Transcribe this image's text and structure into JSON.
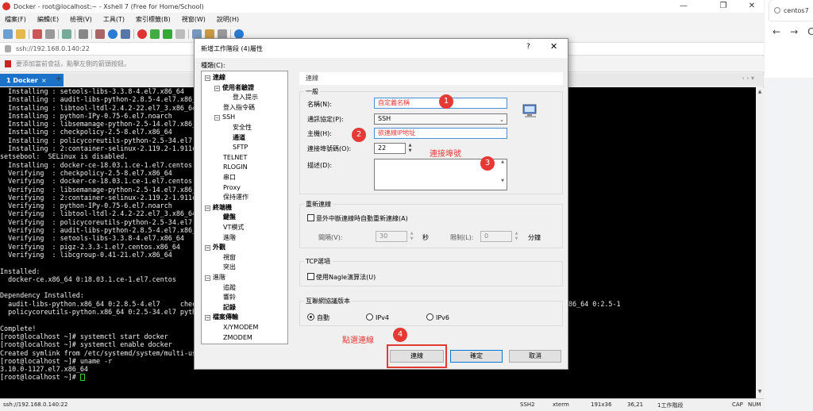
{
  "window": {
    "title": "Docker - root@localhost:~ - Xshell 7 (Free for Home/School)",
    "controls": [
      "—",
      "❐",
      "✕"
    ]
  },
  "menu": [
    "檔案(F)",
    "編輯(E)",
    "檢視(V)",
    "工具(T)",
    "索引標籤(B)",
    "視窗(W)",
    "說明(H)"
  ],
  "address": "ssh://192.168.0.140:22",
  "hint": "要添加當前會話，點擊左側的箭頭按鈕。",
  "tab": {
    "label": "1 Docker",
    "close": "×",
    "add": "+"
  },
  "tab_nav": "‹  ›  ▾",
  "terminal": {
    "lines": [
      "  Installing : setools-libs-3.3.8-4.el7.x86_64",
      "  Installing : audit-libs-python-2.8.5-4.el7.x86_6",
      "  Installing : libtool-ltdl-2.4.2-22.el7_3.x86_64",
      "  Installing : python-IPy-0.75-6.el7.noarch",
      "  Installing : libsemanage-python-2.5-14.el7.x86_6",
      "  Installing : checkpolicy-2.5-8.el7.x86_64",
      "  Installing : policycoreutils-python-2.5-34.el7.",
      "  Installing : 2:container-selinux-2.119.2-1.911c",
      "setsebool:  SELinux is disabled.",
      "  Installing : docker-ce-18.03.1.ce-1.el7.centos.",
      "  Verifying  : checkpolicy-2.5-8.el7.x86_64",
      "  Verifying  : docker-ce-18.03.1.ce-1.el7.centos.",
      "  Verifying  : libsemanage-python-2.5-14.el7.x86_6",
      "  Verifying  : 2:container-selinux-2.119.2-1.911c",
      "  Verifying  : python-IPy-0.75-6.el7.noarch",
      "  Verifying  : libtool-ltdl-2.4.2-22.el7_3.x86_64",
      "  Verifying  : policycoreutils-python-2.5-34.el7.",
      "  Verifying  : audit-libs-python-2.8.5-4.el7.x86_6",
      "  Verifying  : setools-libs-3.3.8-4.el7.x86_64",
      "  Verifying  : pigz-2.3.3-1.el7.centos.x86_64",
      "  Verifying  : libcgroup-0.41-21.el7.x86_64",
      "",
      "Installed:",
      "  docker-ce.x86_64 0:18.03.1.ce-1.el7.centos",
      "",
      "Dependency Installed:",
      "  audit-libs-python.x86_64 0:2.8.5-4.el7     check                                                            0.41-21.el7 libsemanage-python.x86_64 0:2.5-1",
      "  policycoreutils-python.x86_64 0:2.5-34.el7 pytho",
      "",
      "Complete!",
      "[root@localhost ~]# systemctl start docker",
      "[root@localhost ~]# systemctl enable docker",
      "Created symlink from /etc/systemd/system/multi-use",
      "[root@localhost ~]# uname -r",
      "3.10.0-1127.el7.x86_64",
      "[root@localhost ~]# "
    ]
  },
  "statusbar": {
    "address": "ssh://192.168.0.140:22",
    "protocol": "SSH2",
    "term": "xterm",
    "size": "191x36",
    "pos": "36,21",
    "sessions": "1工作階段",
    "caps": "CAP",
    "num": "NUM"
  },
  "browser": {
    "tab_label": "centos7",
    "back": "←",
    "forward": "→",
    "reload": "C"
  },
  "dialog": {
    "title": "新增工作階段 (4)屬性",
    "help": "?",
    "close": "✕",
    "category_label": "種類(C):",
    "tree": [
      {
        "label": "連線",
        "bold": true,
        "expander": "−"
      },
      {
        "label": "使用者驗證",
        "bold": true,
        "expander": "−"
      },
      {
        "label": "登入提示",
        "bold": false
      },
      {
        "label": "登入指令碼",
        "bold": false
      },
      {
        "label": "SSH",
        "bold": false,
        "expander": "−"
      },
      {
        "label": "安全性",
        "bold": false
      },
      {
        "label": "通道",
        "bold": true
      },
      {
        "label": "SFTP",
        "bold": false
      },
      {
        "label": "TELNET",
        "bold": false
      },
      {
        "label": "RLOGIN",
        "bold": false
      },
      {
        "label": "串口",
        "bold": false
      },
      {
        "label": "Proxy",
        "bold": false
      },
      {
        "label": "保持運作",
        "bold": false
      },
      {
        "label": "終端機",
        "bold": true,
        "expander": "−"
      },
      {
        "label": "鍵盤",
        "bold": true
      },
      {
        "label": "VT模式",
        "bold": false
      },
      {
        "label": "進階",
        "bold": false
      },
      {
        "label": "外觀",
        "bold": true,
        "expander": "−"
      },
      {
        "label": "視窗",
        "bold": false
      },
      {
        "label": "突出",
        "bold": false
      },
      {
        "label": "進階",
        "bold": false,
        "expander": "−"
      },
      {
        "label": "追蹤",
        "bold": false
      },
      {
        "label": "響鈴",
        "bold": false
      },
      {
        "label": "記錄",
        "bold": true
      },
      {
        "label": "檔案傳輸",
        "bold": true,
        "expander": "−"
      },
      {
        "label": "X/YMODEM",
        "bold": false
      },
      {
        "label": "ZMODEM",
        "bold": false
      }
    ],
    "section_header": "連線",
    "general": {
      "group_title": "一般",
      "name_label": "名稱(N):",
      "name_value": "自定義名稱",
      "protocol_label": "通訊協定(P):",
      "protocol_value": "SSH",
      "host_label": "主機(H):",
      "host_value": "欲連線IP地址",
      "port_label": "連接埠號碼(O):",
      "port_value": "22",
      "desc_label": "描述(D):"
    },
    "reconnect": {
      "group_title": "重新連線",
      "checkbox_label": "意外中斷連線時自動重新連線(A)",
      "interval_label": "間隔(V):",
      "interval_value": "30",
      "interval_unit": "秒",
      "limit_label": "限制(L):",
      "limit_value": "0",
      "limit_unit": "分鐘"
    },
    "tcp": {
      "group_title": "TCP選項",
      "nagle_label": "使用Nagle演算法(U)"
    },
    "ip_version": {
      "group_title": "互聯網協議版本",
      "options": [
        "自動",
        "IPv4",
        "IPv6"
      ],
      "selected": "自動"
    },
    "buttons": {
      "connect": "連線",
      "ok": "確定",
      "cancel": "取消"
    },
    "annotations": {
      "n1": "1",
      "n2": "2",
      "n3": "3",
      "n4": "4",
      "port_note": "連接埠號",
      "click_connect": "點選連線"
    }
  },
  "colors": {
    "accent": "#1a73c9",
    "annotation": "#e53935",
    "terminal_bg": "#000000"
  }
}
